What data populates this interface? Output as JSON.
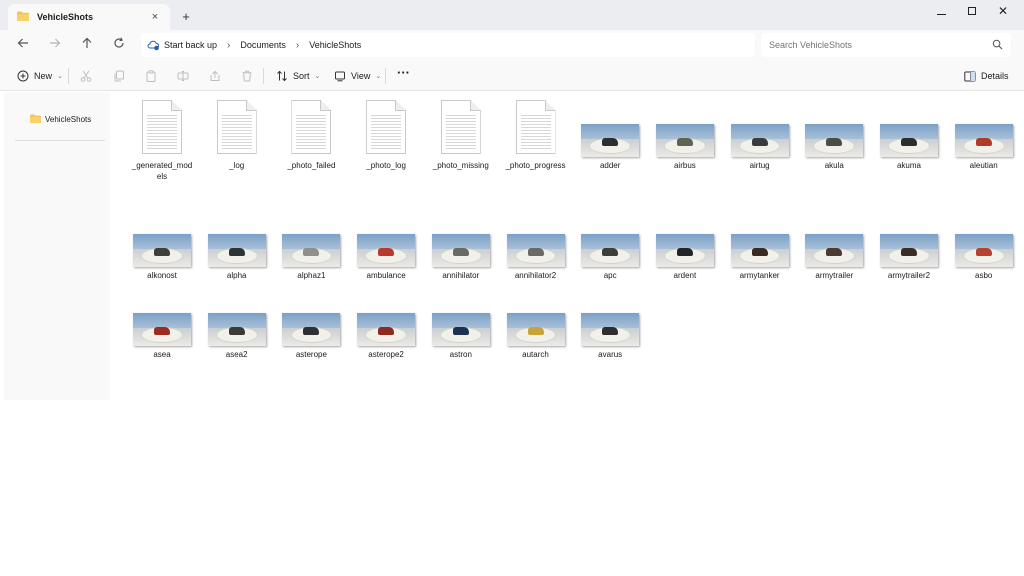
{
  "window": {
    "tab_title": "VehicleShots",
    "tab_close": "×",
    "new_tab": "+",
    "close_glyph": "✕"
  },
  "address": {
    "crumbs": [
      "Start back up",
      "Documents",
      "VehicleShots"
    ]
  },
  "search": {
    "placeholder": "Search VehicleShots"
  },
  "toolbar": {
    "new_label": "New",
    "sort_label": "Sort",
    "view_label": "View",
    "more_label": "···",
    "details_label": "Details"
  },
  "sidebar": {
    "items": [
      {
        "label": "VehicleShots",
        "icon": "folder-icon"
      }
    ]
  },
  "files": [
    {
      "name": "_generated_models",
      "label_lines": [
        "_generated_mod",
        "els"
      ],
      "type": "document"
    },
    {
      "name": "_log",
      "label_lines": [
        "_log"
      ],
      "type": "document"
    },
    {
      "name": "_photo_failed",
      "label_lines": [
        "_photo_failed"
      ],
      "type": "document"
    },
    {
      "name": "_photo_log",
      "label_lines": [
        "_photo_log"
      ],
      "type": "document"
    },
    {
      "name": "_photo_missing",
      "label_lines": [
        "_photo_missing"
      ],
      "type": "document"
    },
    {
      "name": "_photo_progress",
      "label_lines": [
        "_photo_progress"
      ],
      "type": "document"
    },
    {
      "name": "adder",
      "label_lines": [
        "adder"
      ],
      "type": "image",
      "vehicle_color": "#2b2f33"
    },
    {
      "name": "airbus",
      "label_lines": [
        "airbus"
      ],
      "type": "image",
      "vehicle_color": "#5f6452"
    },
    {
      "name": "airtug",
      "label_lines": [
        "airtug"
      ],
      "type": "image",
      "vehicle_color": "#3a3d3e"
    },
    {
      "name": "akula",
      "label_lines": [
        "akula"
      ],
      "type": "image",
      "vehicle_color": "#4b4d47"
    },
    {
      "name": "akuma",
      "label_lines": [
        "akuma"
      ],
      "type": "image",
      "vehicle_color": "#2d2d2d"
    },
    {
      "name": "aleutian",
      "label_lines": [
        "aleutian"
      ],
      "type": "image",
      "vehicle_color": "#b03a2a"
    },
    {
      "name": "alkonost",
      "label_lines": [
        "alkonost"
      ],
      "type": "image",
      "vehicle_color": "#3e3f3b"
    },
    {
      "name": "alpha",
      "label_lines": [
        "alpha"
      ],
      "type": "image",
      "vehicle_color": "#2d3436"
    },
    {
      "name": "alphaz1",
      "label_lines": [
        "alphaz1"
      ],
      "type": "image",
      "vehicle_color": "#8f8f8b"
    },
    {
      "name": "ambulance",
      "label_lines": [
        "ambulance"
      ],
      "type": "image",
      "vehicle_color": "#b8392e"
    },
    {
      "name": "annihilator",
      "label_lines": [
        "annihilator"
      ],
      "type": "image",
      "vehicle_color": "#6a6a64"
    },
    {
      "name": "annihilator2",
      "label_lines": [
        "annihilator2"
      ],
      "type": "image",
      "vehicle_color": "#6a6a64"
    },
    {
      "name": "apc",
      "label_lines": [
        "apc"
      ],
      "type": "image",
      "vehicle_color": "#3c3f38"
    },
    {
      "name": "ardent",
      "label_lines": [
        "ardent"
      ],
      "type": "image",
      "vehicle_color": "#232628"
    },
    {
      "name": "armytanker",
      "label_lines": [
        "armytanker"
      ],
      "type": "image",
      "vehicle_color": "#3b2a22"
    },
    {
      "name": "armytrailer",
      "label_lines": [
        "armytrailer"
      ],
      "type": "image",
      "vehicle_color": "#4a3a30"
    },
    {
      "name": "armytrailer2",
      "label_lines": [
        "armytrailer2"
      ],
      "type": "image",
      "vehicle_color": "#3c2c26"
    },
    {
      "name": "asbo",
      "label_lines": [
        "asbo"
      ],
      "type": "image",
      "vehicle_color": "#b8402f"
    },
    {
      "name": "asea",
      "label_lines": [
        "asea"
      ],
      "type": "image",
      "vehicle_color": "#9e2a22"
    },
    {
      "name": "asea2",
      "label_lines": [
        "asea2"
      ],
      "type": "image",
      "vehicle_color": "#3a3a36"
    },
    {
      "name": "asterope",
      "label_lines": [
        "asterope"
      ],
      "type": "image",
      "vehicle_color": "#2e3033"
    },
    {
      "name": "asterope2",
      "label_lines": [
        "asterope2"
      ],
      "type": "image",
      "vehicle_color": "#8e2a22"
    },
    {
      "name": "astron",
      "label_lines": [
        "astron"
      ],
      "type": "image",
      "vehicle_color": "#1f3050"
    },
    {
      "name": "autarch",
      "label_lines": [
        "autarch"
      ],
      "type": "image",
      "vehicle_color": "#c9a23a"
    },
    {
      "name": "avarus",
      "label_lines": [
        "avarus"
      ],
      "type": "image",
      "vehicle_color": "#2e2e2e"
    }
  ],
  "colors": {
    "folder": "#f3c34f",
    "accent": "#0067c0"
  }
}
